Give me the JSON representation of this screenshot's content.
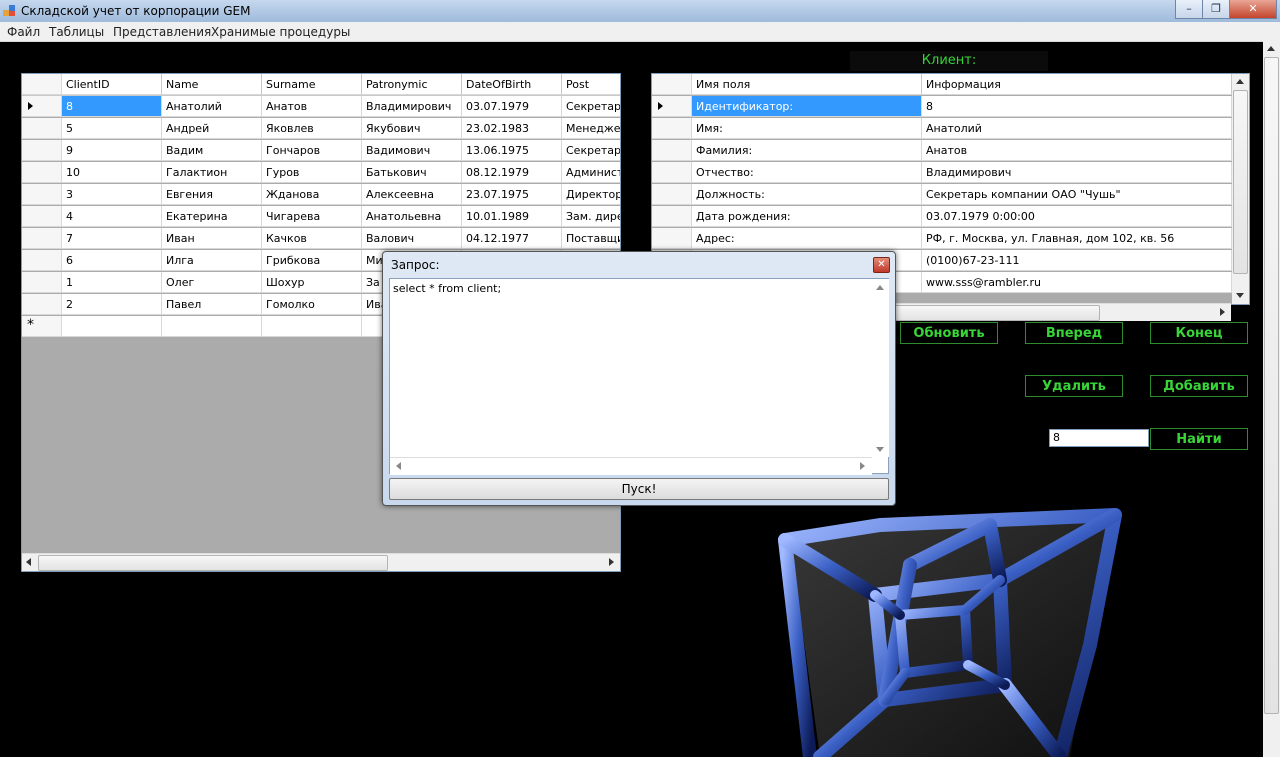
{
  "window": {
    "title": "Складской учет от корпорации GEM",
    "minimize": "–",
    "restore": "❐",
    "close": "✕"
  },
  "menu": [
    "Файл",
    "Таблицы",
    "Представления",
    "Хранимые процедуры"
  ],
  "clients_grid": {
    "columns": [
      "ClientID",
      "Name",
      "Surname",
      "Patronymic",
      "DateOfBirth",
      "Post"
    ],
    "rows": [
      [
        "8",
        "Анатолий",
        "Анатов",
        "Владимирович",
        "03.07.1979",
        "Секретарь"
      ],
      [
        "5",
        "Андрей",
        "Яковлев",
        "Якубович",
        "23.02.1983",
        "Менеджер"
      ],
      [
        "9",
        "Вадим",
        "Гончаров",
        "Вадимович",
        "13.06.1975",
        "Секретарь"
      ],
      [
        "10",
        "Галактион",
        "Гуров",
        "Батькович",
        "08.12.1979",
        "Администр"
      ],
      [
        "3",
        "Евгения",
        "Жданова",
        "Алексеевна",
        "23.07.1975",
        "Директор"
      ],
      [
        "4",
        "Екатерина",
        "Чигарева",
        "Анатольевна",
        "10.01.1989",
        "Зам. дирек"
      ],
      [
        "7",
        "Иван",
        "Качков",
        "Валович",
        "04.12.1977",
        "Поставщик"
      ],
      [
        "6",
        "Илга",
        "Грибкова",
        "Ми",
        "",
        ""
      ],
      [
        "1",
        "Олег",
        "Шохур",
        "За",
        "",
        ""
      ],
      [
        "2",
        "Павел",
        "Гомолко",
        "Ива",
        "",
        ""
      ]
    ],
    "new_row_marker": "*"
  },
  "client_label": "Клиент:",
  "details_grid": {
    "columns": [
      "Имя поля",
      "Информация"
    ],
    "rows": [
      [
        "Идентификатор:",
        "8"
      ],
      [
        "Имя:",
        "Анатолий"
      ],
      [
        "Фамилия:",
        "Анатов"
      ],
      [
        "Отчество:",
        "Владимирович"
      ],
      [
        "Должность:",
        "Секретарь компании ОАО \"Чушь\""
      ],
      [
        "Дата рождения:",
        "03.07.1979 0:00:00"
      ],
      [
        "Адрес:",
        "РФ, г. Москва, ул. Главная, дом 102, кв. 56"
      ],
      [
        "",
        "(0100)67-23-111"
      ],
      [
        "",
        "www.sss@rambler.ru"
      ]
    ]
  },
  "buttons": {
    "refresh": "Обновить",
    "forward": "Вперед",
    "end": "Конец",
    "delete": "Удалить",
    "add": "Добавить",
    "find": "Найти"
  },
  "find_input_value": "8",
  "dialog": {
    "title": "Запрос:",
    "query": "select * from client;",
    "run": "Пуск!"
  }
}
